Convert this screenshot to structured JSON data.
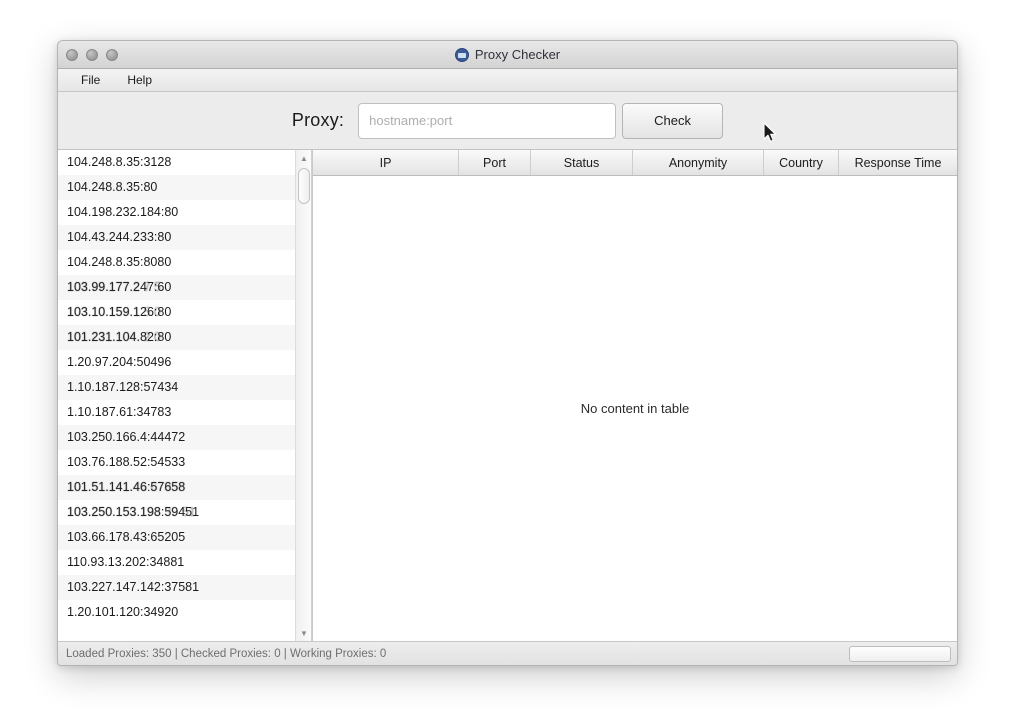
{
  "window": {
    "title": "Proxy Checker",
    "app_icon": "app-circle-icon",
    "traffic_lights": [
      "close-button",
      "minimize-button",
      "maximize-button"
    ]
  },
  "menubar": {
    "items": [
      {
        "label": "File"
      },
      {
        "label": "Help"
      }
    ]
  },
  "toolbar": {
    "proxy_label": "Proxy:",
    "input_value": "",
    "input_placeholder": "hostname:port",
    "check_label": "Check"
  },
  "proxy_list": {
    "items": [
      {
        "text": "104.248.8.35:3128",
        "ghost": ""
      },
      {
        "text": "104.248.8.35:80",
        "ghost": ""
      },
      {
        "text": "104.198.232.184:80",
        "ghost": ""
      },
      {
        "text": "104.43.244.233:80",
        "ghost": ""
      },
      {
        "text": "104.248.8.35:8080",
        "ghost": ""
      },
      {
        "text": "103.99.177.247:60",
        "ghost": "103.99.177.2 7 5 "
      },
      {
        "text": "103.10.159.126:80",
        "ghost": "103.10.159.1 5 0 "
      },
      {
        "text": "101.231.104.82:80",
        "ghost": "101.231.104. 2 0 "
      },
      {
        "text": "1.20.97.204:50496",
        "ghost": ""
      },
      {
        "text": "1.10.187.128:57434",
        "ghost": ""
      },
      {
        "text": "1.10.187.61:34783",
        "ghost": ""
      },
      {
        "text": "103.250.166.4:44472",
        "ghost": ""
      },
      {
        "text": "103.76.188.52:54533",
        "ghost": ""
      },
      {
        "text": "101.51.141.46:57658",
        "ghost": "101.51.141.46 67858"
      },
      {
        "text": "103.250.153.198:59451",
        "ghost": "103.250.153 193 39 51"
      },
      {
        "text": "103.66.178.43:65205",
        "ghost": ""
      },
      {
        "text": "110.93.13.202:34881",
        "ghost": ""
      },
      {
        "text": "103.227.147.142:37581",
        "ghost": ""
      },
      {
        "text": "1.20.101.120:34920",
        "ghost": ""
      }
    ]
  },
  "table": {
    "columns": [
      {
        "label": "IP",
        "width": 146
      },
      {
        "label": "Port",
        "width": 72
      },
      {
        "label": "Status",
        "width": 102
      },
      {
        "label": "Anonymity",
        "width": 131
      },
      {
        "label": "Country",
        "width": 75
      },
      {
        "label": "Response Time",
        "width": 119
      }
    ],
    "empty_message": "No content in table"
  },
  "statusbar": {
    "text": "Loaded Proxies: 350  |  Checked Proxies: 0  |  Working Proxies: 0",
    "loaded_proxies": 350,
    "checked_proxies": 0,
    "working_proxies": 0,
    "progress_percent": 0
  },
  "colors": {
    "window_chrome": "#ececec",
    "title_bar": "#dcdcdc",
    "app_icon": "#3b5a98",
    "row_alt": "#f6f6f6",
    "status_text": "#6e6e6e"
  }
}
